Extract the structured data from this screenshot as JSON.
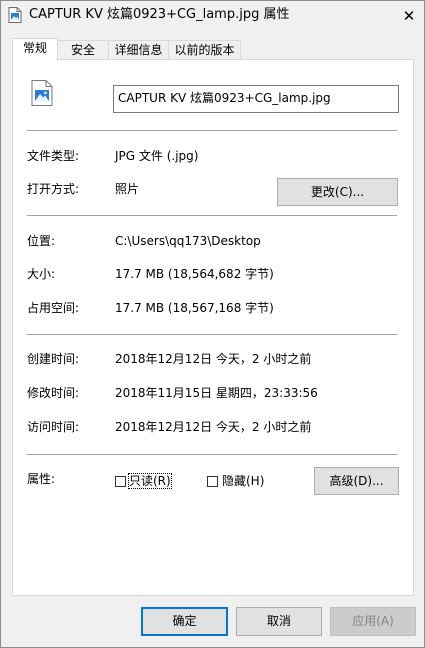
{
  "window": {
    "title": "CAPTUR KV 炫篇0923+CG_lamp.jpg 属性",
    "close_glyph": "✕"
  },
  "tabs": [
    {
      "label": "常规",
      "active": true
    },
    {
      "label": "安全",
      "active": false
    },
    {
      "label": "详细信息",
      "active": false
    },
    {
      "label": "以前的版本",
      "active": false
    }
  ],
  "file": {
    "icon": "image-file-icon",
    "name": "CAPTUR KV 炫篇0923+CG_lamp.jpg"
  },
  "type_section": {
    "file_type_label": "文件类型:",
    "file_type_value": "JPG 文件 (.jpg)",
    "opens_with_label": "打开方式:",
    "opens_with_value": "照片",
    "change_button": "更改(C)..."
  },
  "location_section": {
    "location_label": "位置:",
    "location_value": "C:\\Users\\qq173\\Desktop",
    "size_label": "大小:",
    "size_value": "17.7 MB (18,564,682 字节)",
    "size_on_disk_label": "占用空间:",
    "size_on_disk_value": "17.7 MB (18,567,168 字节)"
  },
  "time_section": {
    "created_label": "创建时间:",
    "created_value": "2018年12月12日 今天，2 小时之前",
    "modified_label": "修改时间:",
    "modified_value": "2018年11月15日 星期四，23:33:56",
    "accessed_label": "访问时间:",
    "accessed_value": "2018年12月12日 今天，2 小时之前"
  },
  "attributes": {
    "label": "属性:",
    "readonly_label": "只读(R)",
    "readonly_checked": false,
    "hidden_label": "隐藏(H)",
    "hidden_checked": false,
    "advanced_button": "高级(D)..."
  },
  "footer": {
    "ok": "确定",
    "cancel": "取消",
    "apply": "应用(A)"
  },
  "colors": {
    "primary_border": "#0078d7",
    "image_icon_blue": "#2b7cd3"
  }
}
